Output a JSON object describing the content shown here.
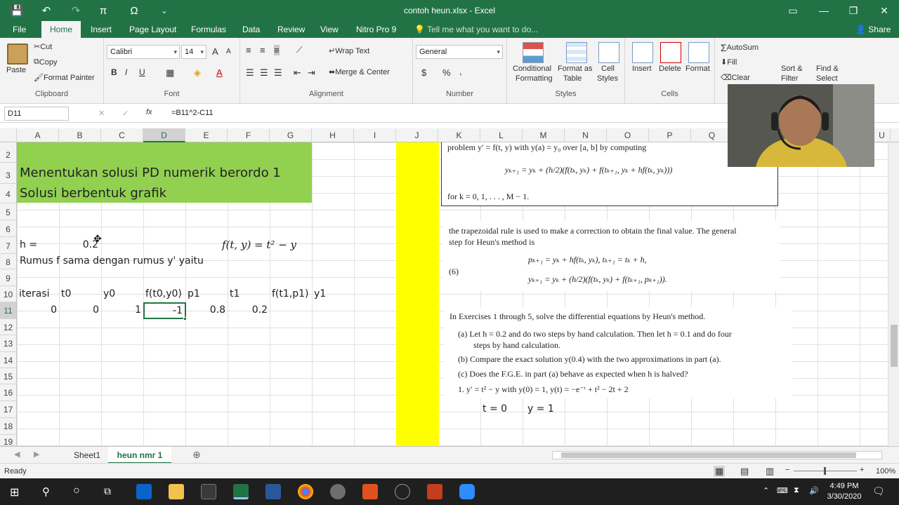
{
  "window": {
    "title": "contoh heun.xlsx - Excel"
  },
  "qat": {
    "save": "💾",
    "undo": "↶",
    "redo": "↷",
    "pi": "π",
    "omega": "Ω",
    "more": "⌄"
  },
  "tabs": [
    "File",
    "Home",
    "Insert",
    "Page Layout",
    "Formulas",
    "Data",
    "Review",
    "View",
    "Nitro Pro 9"
  ],
  "tellme": "Tell me what you want to do...",
  "share": "Share",
  "ribbon": {
    "clipboard": {
      "paste": "Paste",
      "cut": "Cut",
      "copy": "Copy",
      "format_painter": "Format Painter",
      "label": "Clipboard"
    },
    "font": {
      "name": "Calibri",
      "size": "14",
      "label": "Font",
      "bold": "B",
      "italic": "I",
      "underline": "U",
      "grow": "A",
      "shrink": "A"
    },
    "alignment": {
      "wrap": "Wrap Text",
      "merge": "Merge & Center",
      "label": "Alignment"
    },
    "number": {
      "format": "General",
      "currency": "$",
      "percent": "%",
      "comma": ",",
      "label": "Number"
    },
    "styles": {
      "conditional": "Conditional",
      "conditional2": "Formatting",
      "format_as": "Format as",
      "format_as2": "Table",
      "cell": "Cell",
      "cell2": "Styles",
      "label": "Styles"
    },
    "cells": {
      "insert": "Insert",
      "delete": "Delete",
      "format": "Format",
      "label": "Cells"
    },
    "editing": {
      "autosum": "AutoSum",
      "fill": "Fill",
      "clear": "Clear",
      "sort": "Sort &",
      "sort2": "Filter",
      "find": "Find &",
      "find2": "Select"
    }
  },
  "formula_bar": {
    "name_box": "D11",
    "fx": "fx",
    "formula": "=B11^2-C11"
  },
  "columns": [
    "A",
    "B",
    "C",
    "D",
    "E",
    "F",
    "G",
    "H",
    "I",
    "J",
    "K",
    "L",
    "M",
    "N",
    "O",
    "P",
    "Q",
    "U"
  ],
  "rows": [
    "2",
    "3",
    "4",
    "5",
    "6",
    "7",
    "8",
    "9",
    "10",
    "11",
    "12",
    "13",
    "14",
    "15",
    "16",
    "17",
    "18",
    "19"
  ],
  "cells": {
    "title1": "Menentukan solusi PD numerik berordo 1",
    "title2": "Solusi berbentuk grafik",
    "h_label": "h =",
    "h_value": "0.2",
    "f_eq": "f(t, y) = t² − y",
    "rumus": "Rumus f sama dengan rumus y' yaitu",
    "headers": [
      "iterasi",
      "t0",
      "y0",
      "f(t0,y0)",
      "p1",
      "t1",
      "f(t1,p1)",
      "y1"
    ],
    "row11": [
      "0",
      "0",
      "1",
      "-1",
      "0.8",
      "0.2"
    ]
  },
  "textbook": {
    "box_line1": "problem y′ = f(t, y) with y(a) = y₀ over [a, b] by computing",
    "box_eq": "yₖ₊₁ = yₖ + (h/2)(f(tₖ, yₖ) + f(tₖ₊₁, yₖ + hf(tₖ, yₖ)))",
    "box_line3": "for k = 0, 1, . . . , M − 1.",
    "para1": "the trapezoidal rule is used to make a correction to obtain the final value. The general",
    "para2": "step for Heun's method is",
    "eq_num": "(6)",
    "eq1": "pₖ₊₁ = yₖ + hf(tₖ, yₖ),      tₖ₊₁ = tₖ + h,",
    "eq2": "yₖ₊₁ = yₖ + (h/2)(f(tₖ, yₖ) + f(tₖ₊₁, pₖ₊₁)).",
    "ex_intro": "In Exercises 1 through 5, solve the differential equations by Heun's method.",
    "a1": "(a)  Let h = 0.2 and do two steps by hand calculation.  Then let h = 0.1 and do four",
    "a2": "steps by hand calculation.",
    "b": "(b)  Compare the exact solution y(0.4) with the two approximations in part (a).",
    "c": "(c)  Does the F.G.E. in part (a) behave as expected when h is halved?",
    "ex1": "1.  y′ = t² − y with y(0) = 1, y(t) = −e⁻ᵗ + t² − 2t + 2",
    "t0": "t = 0",
    "y1": "y = 1"
  },
  "sheets": [
    "Sheet1",
    "heun nmr 1"
  ],
  "status": {
    "ready": "Ready",
    "zoom": "100%"
  },
  "clock": {
    "time": "4:49 PM",
    "date": "3/30/2020"
  },
  "colors": {
    "excel_green": "#217346",
    "band_green": "#92d050",
    "band_yellow": "#ffff00"
  }
}
